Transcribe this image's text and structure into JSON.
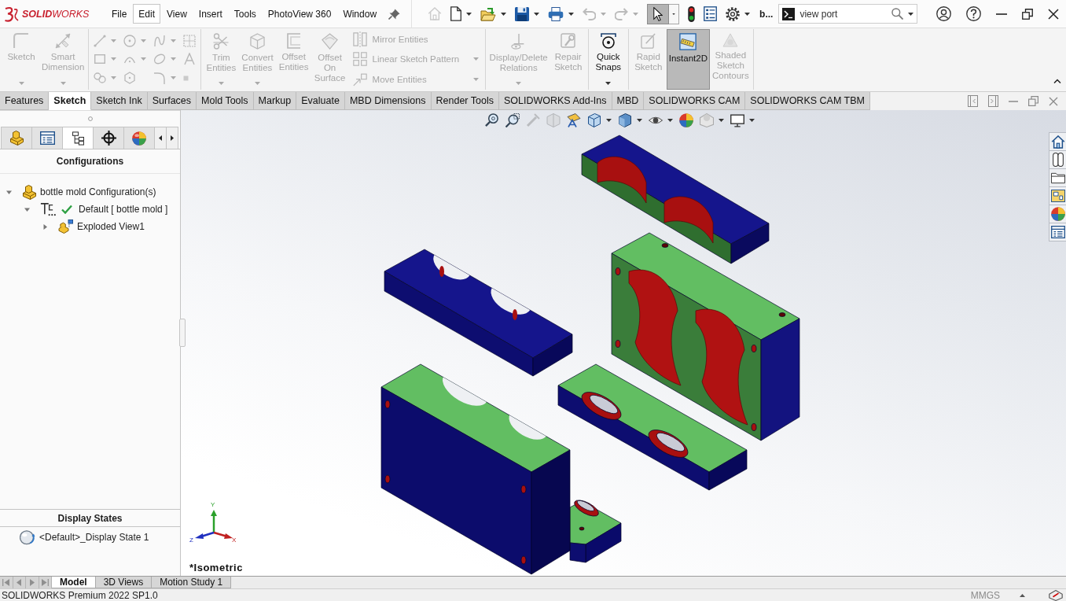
{
  "title_bar": {
    "logo": "**SOLID**WORKS",
    "menu": [
      {
        "label": "File",
        "selected": false
      },
      {
        "label": "Edit",
        "selected": true
      },
      {
        "label": "View",
        "selected": false
      },
      {
        "label": "Insert",
        "selected": false
      },
      {
        "label": "Tools",
        "selected": false
      },
      {
        "label": "PhotoView 360",
        "selected": false
      },
      {
        "label": "Window",
        "selected": false
      }
    ],
    "quick_access": [
      {
        "disabled": true,
        "on": false,
        "dropdown": false
      },
      {
        "disabled": false,
        "on": false,
        "dropdown": true
      },
      {
        "disabled": false,
        "on": false,
        "dropdown": true
      },
      {
        "disabled": false,
        "on": false,
        "dropdown": true
      },
      {
        "disabled": false,
        "on": false,
        "dropdown": true
      },
      {
        "disabled": true,
        "on": false,
        "dropdown": true
      },
      {
        "disabled": true,
        "on": false,
        "dropdown": true
      },
      {
        "disabled": false,
        "on": true,
        "dropdown": true
      },
      {
        "disabled": false,
        "on": false,
        "dropdown": false
      },
      {
        "disabled": false,
        "on": false,
        "dropdown": false
      },
      {
        "disabled": false,
        "on": false,
        "dropdown": true
      }
    ],
    "document_name": "b...",
    "search": {
      "value": "view port"
    }
  },
  "ribbon": {
    "groups": [
      [
        {
          "kind": "large",
          "label": "Sketch",
          "disabled": true,
          "on": false,
          "dropdown": true
        },
        {
          "kind": "large",
          "label": "Smart Dimension",
          "disabled": true,
          "on": false,
          "dropdown": true
        }
      ],
      [
        {
          "kind": "grid",
          "disabled": true,
          "tools": [
            {
              "dropdown": true
            },
            {
              "dropdown": true
            },
            {
              "dropdown": true
            },
            {
              "dropdown": false
            },
            {
              "dropdown": true
            },
            {
              "dropdown": true
            },
            {
              "dropdown": true
            },
            {
              "dropdown": false
            },
            {
              "dropdown": true
            },
            {
              "dropdown": false
            },
            {
              "dropdown": true
            },
            {
              "dropdown": false
            }
          ]
        }
      ],
      [
        {
          "kind": "large",
          "label": "Trim Entities",
          "disabled": true,
          "on": false,
          "dropdown": true
        },
        {
          "kind": "large",
          "label": "Convert Entities",
          "disabled": true,
          "on": false,
          "dropdown": true
        },
        {
          "kind": "large",
          "label": "Offset Entities",
          "disabled": true,
          "on": false,
          "dropdown": false
        },
        {
          "kind": "large",
          "label": "Offset On Surface",
          "disabled": true,
          "on": false,
          "dropdown": false
        },
        {
          "kind": "stack",
          "items": [
            {
              "label": "Mirror Entities",
              "disabled": true,
              "dropdown": false
            },
            {
              "label": "Linear Sketch Pattern",
              "disabled": true,
              "dropdown": true
            },
            {
              "label": "Move Entities",
              "disabled": true,
              "dropdown": true
            }
          ]
        }
      ],
      [
        {
          "kind": "large",
          "label": "Display/Delete Relations",
          "disabled": true,
          "on": false,
          "dropdown": true
        },
        {
          "kind": "large",
          "label": "Repair Sketch",
          "disabled": true,
          "on": false,
          "dropdown": false
        }
      ],
      [
        {
          "kind": "large",
          "label": "Quick Snaps",
          "disabled": false,
          "on": false,
          "dropdown": true
        }
      ],
      [
        {
          "kind": "large",
          "label": "Rapid Sketch",
          "disabled": true,
          "on": false,
          "dropdown": false
        },
        {
          "kind": "large",
          "label": "Instant2D",
          "disabled": false,
          "on": true,
          "dropdown": false
        },
        {
          "kind": "large",
          "label": "Shaded Sketch Contours",
          "disabled": true,
          "on": false,
          "dropdown": false
        }
      ]
    ]
  },
  "command_tabs": [
    {
      "label": "Features",
      "selected": false
    },
    {
      "label": "Sketch",
      "selected": true
    },
    {
      "label": "Sketch Ink",
      "selected": false
    },
    {
      "label": "Surfaces",
      "selected": false
    },
    {
      "label": "Mold Tools",
      "selected": false
    },
    {
      "label": "Markup",
      "selected": false
    },
    {
      "label": "Evaluate",
      "selected": false
    },
    {
      "label": "MBD Dimensions",
      "selected": false
    },
    {
      "label": "Render Tools",
      "selected": false
    },
    {
      "label": "SOLIDWORKS Add-Ins",
      "selected": false
    },
    {
      "label": "MBD",
      "selected": false
    },
    {
      "label": "SOLIDWORKS CAM",
      "selected": false
    },
    {
      "label": "SOLIDWORKS CAM TBM",
      "selected": false
    }
  ],
  "manager_panel": {
    "tabs": [
      {
        "selected": false
      },
      {
        "selected": false
      },
      {
        "selected": true
      },
      {
        "selected": false
      },
      {
        "selected": false
      }
    ],
    "title": "Configurations",
    "tree": [
      {
        "kind": "configurations",
        "label": "bottle mold Configuration(s)",
        "expanded": true,
        "children": [
          {
            "kind": "configuration",
            "label": "Default [ bottle mold ]",
            "expanded": true,
            "active": true,
            "children": [
              {
                "kind": "exploded-view",
                "label": "Exploded View1",
                "expanded": false
              }
            ]
          }
        ]
      }
    ],
    "display_states": {
      "title": "Display States",
      "items": [
        {
          "label": "<Default>_Display State 1"
        }
      ]
    }
  },
  "graphics_area": {
    "view_toolbar": [
      {
        "disabled": false,
        "dropdown": false
      },
      {
        "disabled": false,
        "dropdown": false
      },
      {
        "disabled": true,
        "dropdown": false
      },
      {
        "disabled": true,
        "dropdown": false
      },
      {
        "disabled": false,
        "dropdown": false
      },
      {
        "disabled": false,
        "dropdown": true
      },
      {
        "disabled": false,
        "dropdown": true
      },
      {
        "disabled": false,
        "dropdown": true
      },
      {
        "disabled": false,
        "dropdown": false
      },
      {
        "disabled": false,
        "dropdown": true
      },
      {
        "disabled": false,
        "dropdown": true
      }
    ],
    "axis_labels": {
      "x": "X",
      "y": "Y",
      "z": "Z"
    },
    "view_name": "*Isometric"
  },
  "bottom_bar": {
    "nav_buttons": [
      {
        "disabled": true
      },
      {
        "disabled": true
      },
      {
        "disabled": true
      },
      {
        "disabled": true
      }
    ],
    "tabs": [
      {
        "label": "Model",
        "selected": true
      },
      {
        "label": "3D Views",
        "selected": false
      },
      {
        "label": "Motion Study 1",
        "selected": false
      }
    ]
  },
  "status_bar": {
    "text": "SOLIDWORKS Premium 2022 SP1.0",
    "units": "MMGS"
  }
}
